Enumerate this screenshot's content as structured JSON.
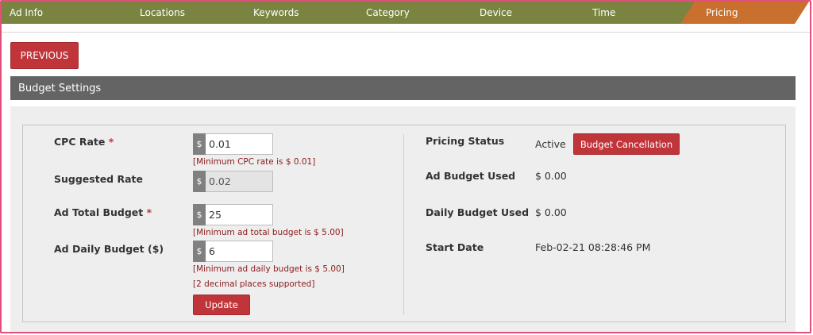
{
  "wizard": {
    "steps": [
      {
        "label": "Ad Info",
        "active": false
      },
      {
        "label": "Locations",
        "active": false
      },
      {
        "label": "Keywords",
        "active": false
      },
      {
        "label": "Category",
        "active": false
      },
      {
        "label": "Device",
        "active": false
      },
      {
        "label": "Time",
        "active": false
      },
      {
        "label": "Pricing",
        "active": true
      }
    ],
    "inactive_color": "#7a8440",
    "active_color": "#c9702f"
  },
  "actions": {
    "previous_label": "PREVIOUS",
    "update_label": "Update",
    "cancel_label": "Budget Cancellation"
  },
  "section": {
    "title": "Budget Settings"
  },
  "form": {
    "currency_symbol": "$",
    "required_marker": "*",
    "cpc_rate": {
      "label": "CPC Rate",
      "value": "0.01",
      "help": "[Minimum CPC rate is $ 0.01]"
    },
    "suggested_rate": {
      "label": "Suggested Rate",
      "value": "0.02"
    },
    "ad_total_budget": {
      "label": "Ad Total Budget",
      "value": "25",
      "help": "[Minimum ad total budget is $ 5.00]"
    },
    "ad_daily_budget": {
      "label": "Ad Daily Budget ($)",
      "value": "6",
      "help": "[Minimum ad daily budget is $ 5.00]",
      "help2": "[2 decimal places supported]"
    }
  },
  "status": {
    "pricing_status": {
      "label": "Pricing Status",
      "value": "Active"
    },
    "ad_budget_used": {
      "label": "Ad Budget Used",
      "value": "$ 0.00"
    },
    "daily_budget_used": {
      "label": "Daily Budget Used",
      "value": "$ 0.00"
    },
    "start_date": {
      "label": "Start Date",
      "value": "Feb-02-21 08:28:46 PM"
    }
  },
  "colors": {
    "accent_red": "#c0353a",
    "header_gray": "#646464",
    "help_text": "#8b1a1a"
  }
}
